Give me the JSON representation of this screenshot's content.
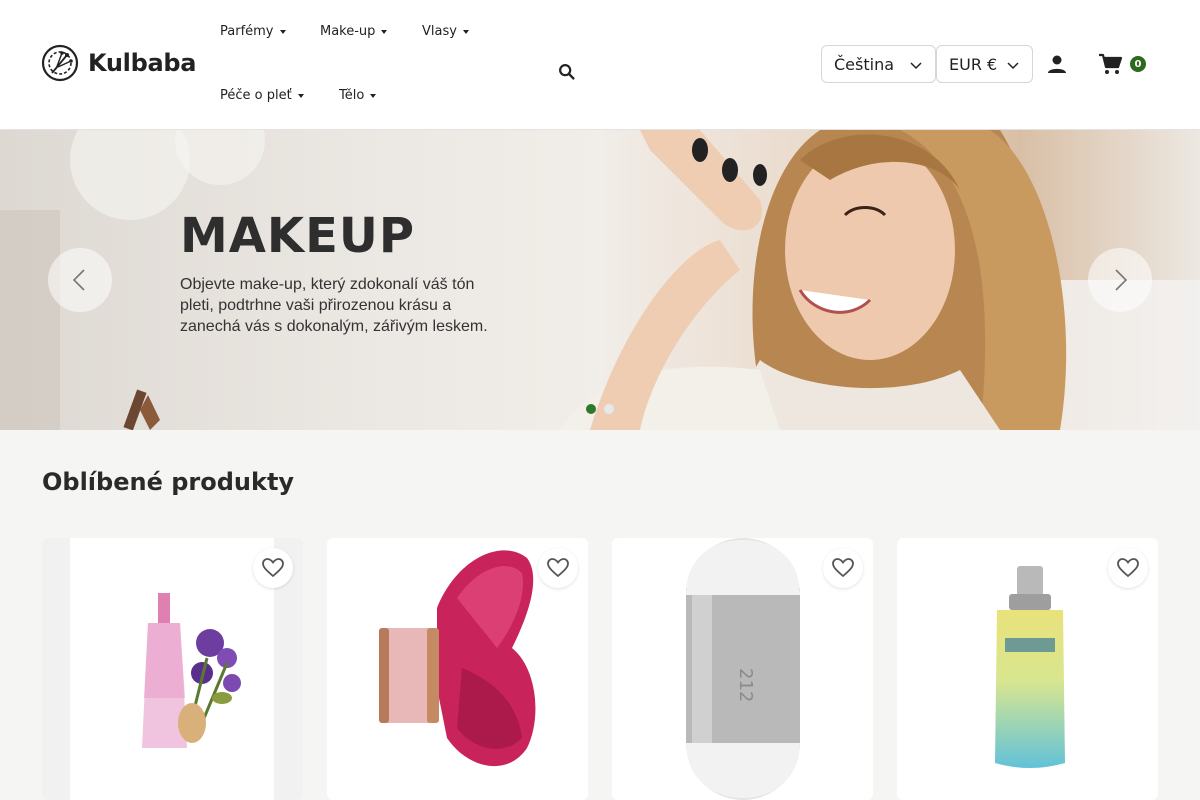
{
  "brand": {
    "name": "Kulbaba",
    "accent": "#2d6a1f"
  },
  "nav": {
    "items": [
      {
        "label": "Parfémy"
      },
      {
        "label": "Make-up"
      },
      {
        "label": "Vlasy"
      },
      {
        "label": "Péče o pleť"
      },
      {
        "label": "Tělo"
      }
    ]
  },
  "header": {
    "language": "Čeština",
    "currency": "EUR €",
    "cart_count": "0",
    "icons": [
      "search-icon",
      "account-icon",
      "cart-icon",
      "chevron-down-icon"
    ]
  },
  "hero": {
    "title": "MAKEUP",
    "subtitle": "Objevte make-up, který zdokonalí váš tón pleti, podtrhne vaši přirozenou krásu a zanechá vás s dokonalým, zářivým leskem.",
    "slide_count": 2,
    "active_slide": 1
  },
  "featured": {
    "title": "Oblíbené produkty",
    "products": [
      {
        "image": "pink-flower-perfume-bottle"
      },
      {
        "image": "red-butterfly-perfume-bottle"
      },
      {
        "image": "silver-capsule-perfume-bottle"
      },
      {
        "image": "blue-yellow-perfume-bottle"
      }
    ]
  }
}
